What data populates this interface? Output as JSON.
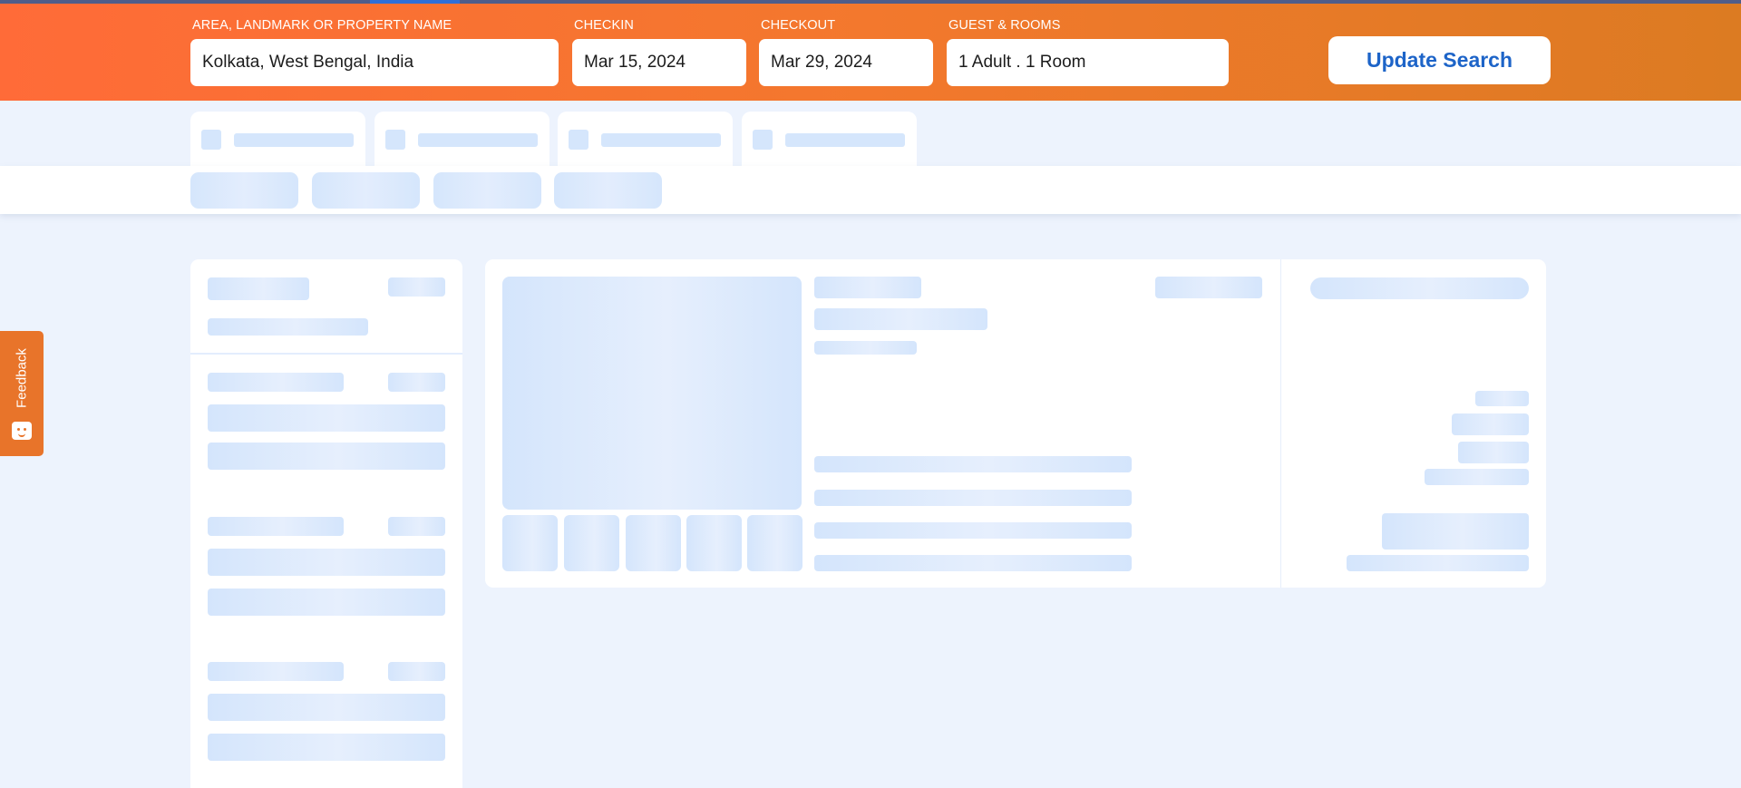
{
  "search": {
    "area_label": "AREA, LANDMARK OR PROPERTY NAME",
    "area_value": "Kolkata, West Bengal, India",
    "checkin_label": "CHECKIN",
    "checkin_value": "Mar 15, 2024",
    "checkout_label": "CHECKOUT",
    "checkout_value": "Mar 29, 2024",
    "guests_label": "GUEST & ROOMS",
    "guests_value": "1 Adult  . 1 Room",
    "update_label": "Update Search"
  },
  "feedback": {
    "label": "Feedback",
    "icon": "smiley-chat-icon"
  },
  "colors": {
    "header_start": "#ff6b38",
    "header_end": "#dc7b22",
    "accent_blue": "#1d64c8",
    "skeleton": "#d5e6fc",
    "page_bg": "#edf3fd"
  }
}
